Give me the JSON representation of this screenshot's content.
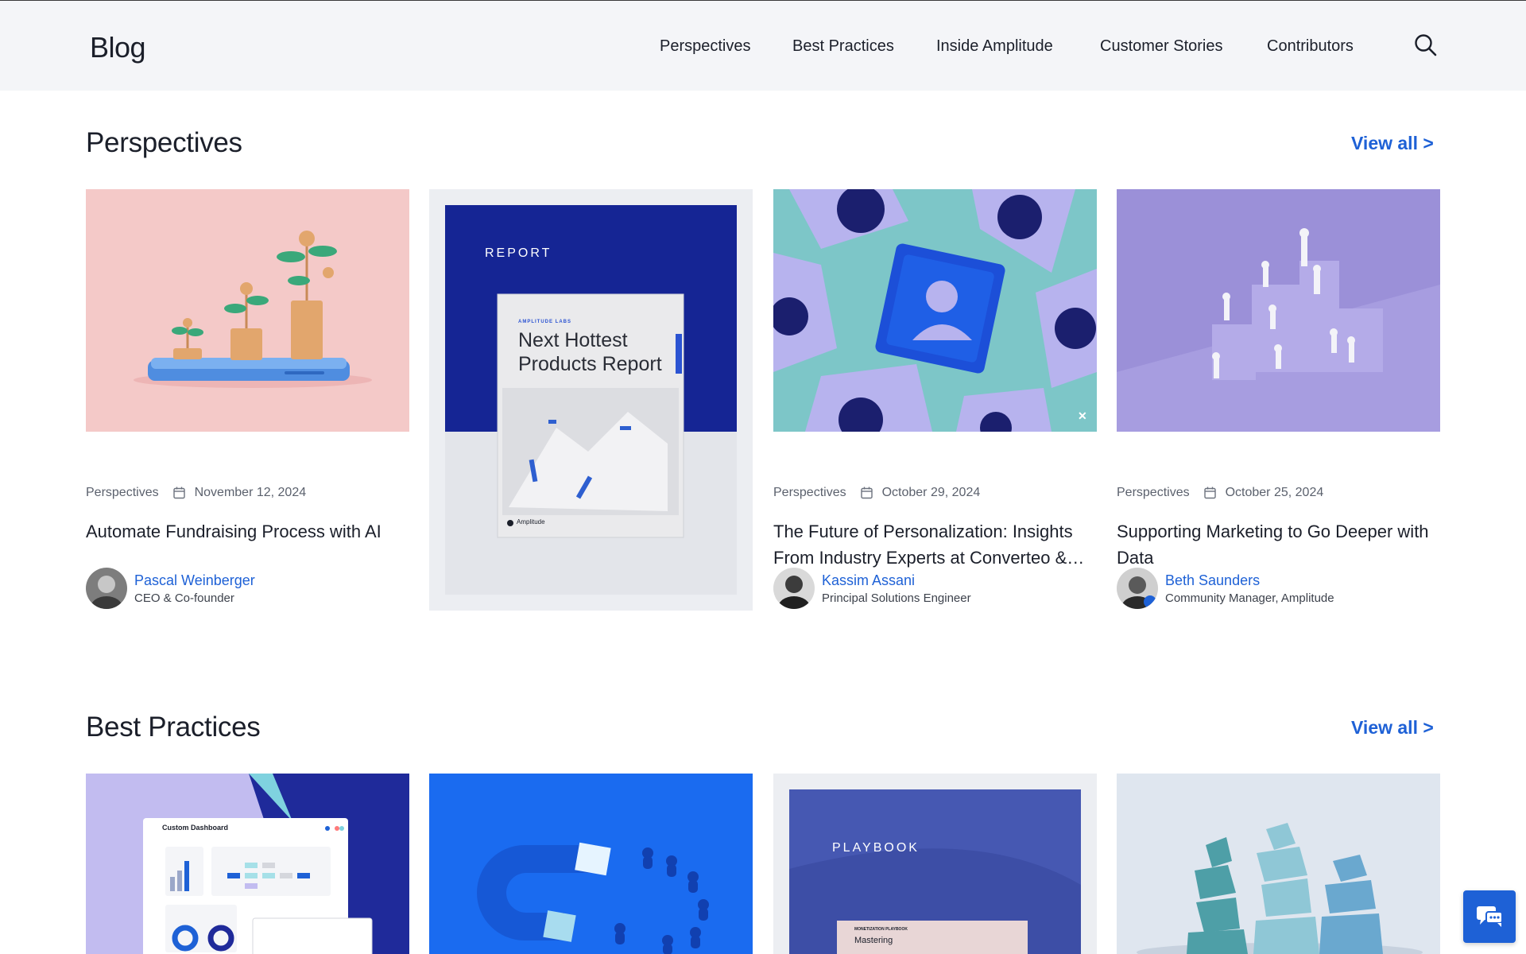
{
  "header": {
    "logo": "Blog",
    "nav": [
      "Perspectives",
      "Best Practices",
      "Inside Amplitude",
      "Customer Stories",
      "Contributors"
    ],
    "search_icon": "search-icon"
  },
  "sections": {
    "perspectives": {
      "title": "Perspectives",
      "view_all": "View all  >",
      "cards": [
        {
          "category": "Perspectives",
          "date": "November 12, 2024",
          "title": "Automate Fundraising Process with AI",
          "author": "Pascal Weinberger",
          "role": "CEO & Co-founder"
        },
        {
          "report_label": "REPORT",
          "report_brand": "AMPLITUDE LABS",
          "report_title_line1": "Next Hottest",
          "report_title_line2": "Products Report",
          "report_footer": "Amplitude"
        },
        {
          "category": "Perspectives",
          "date": "October 29, 2024",
          "title": "The Future of Personalization: Insights From Industry Experts at Converteo &…",
          "author": "Kassim Assani",
          "role": "Principal Solutions Engineer"
        },
        {
          "category": "Perspectives",
          "date": "October 25, 2024",
          "title": "Supporting Marketing to Go Deeper with Data",
          "author": "Beth Saunders",
          "role": "Community Manager, Amplitude"
        }
      ]
    },
    "best_practices": {
      "title": "Best Practices",
      "view_all": "View all  >",
      "dashboard_label": "Custom Dashboard",
      "playbook_label": "PLAYBOOK",
      "playbook_sub": "MONETIZATION PLAYBOOK",
      "playbook_title": "Mastering"
    }
  },
  "colors": {
    "accent": "#1e61d6",
    "header_bg": "#f4f5f8",
    "report_navy": "#152594"
  }
}
